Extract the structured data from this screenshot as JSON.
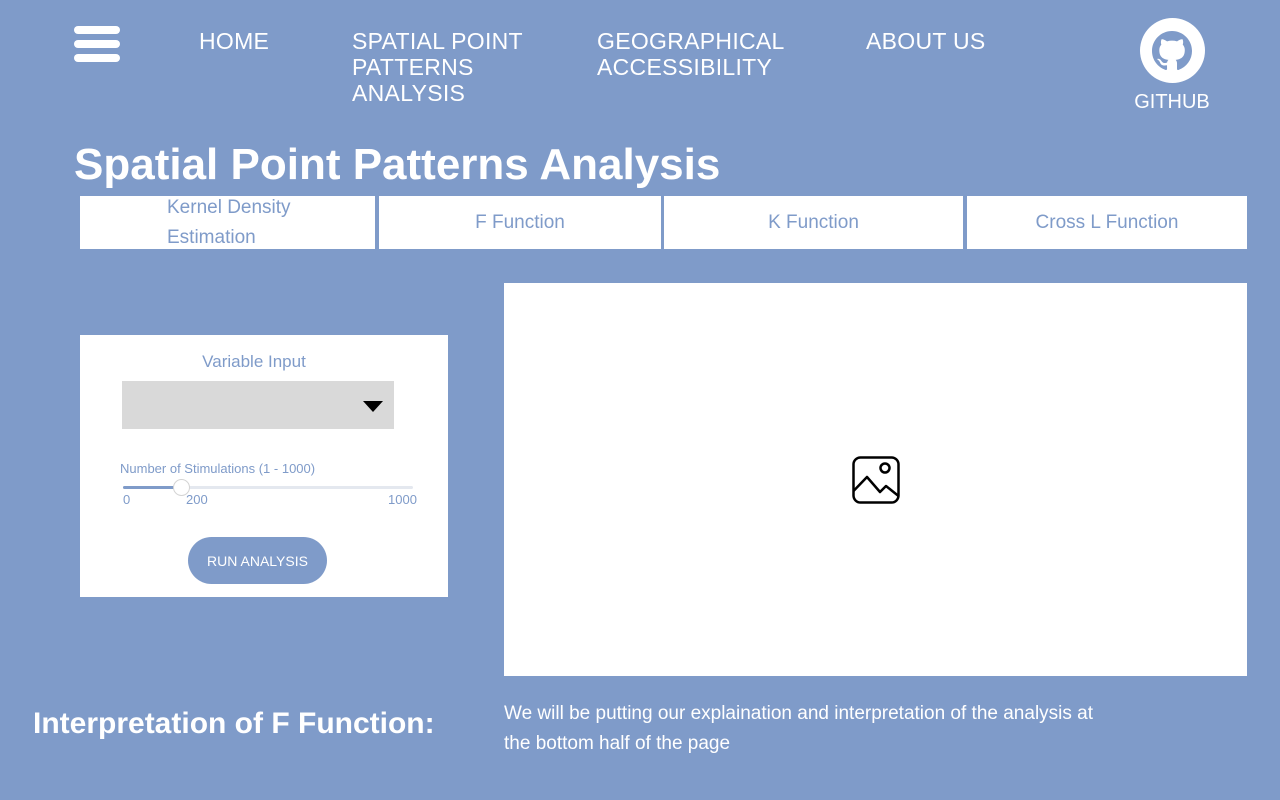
{
  "nav": {
    "menu_icon": "hamburger-menu-icon",
    "links": [
      {
        "label": "HOME"
      },
      {
        "label": "SPATIAL POINT PATTERNS ANALYSIS"
      },
      {
        "label": "GEOGRAPHICAL ACCESSIBILITY"
      },
      {
        "label": "ABOUT US"
      }
    ],
    "github": {
      "icon": "github-icon",
      "label": "GITHUB"
    }
  },
  "page_title": "Spatial Point Patterns Analysis",
  "tabs": [
    {
      "label": "Kernel Density Estimation"
    },
    {
      "label": "F Function"
    },
    {
      "label": "K Function"
    },
    {
      "label": "Cross L Function"
    }
  ],
  "controls": {
    "variable_input": {
      "label": "Variable Input",
      "value": ""
    },
    "simulations": {
      "label": "Number of Stimulations (1 - 1000)",
      "min": 0,
      "max": 1000,
      "value": 200,
      "min_label": "0",
      "value_label": "200",
      "max_label": "1000"
    },
    "run_button": "RUN ANALYSIS"
  },
  "output": {
    "placeholder_icon": "image-placeholder-icon"
  },
  "interpretation": {
    "heading": "Interpretation of F Function:",
    "text": "We will be putting our explaination and interpretation of the analysis at the bottom half of the page"
  },
  "colors": {
    "background": "#7f9bc9",
    "panel": "#ffffff",
    "select": "#d9d9d9"
  }
}
